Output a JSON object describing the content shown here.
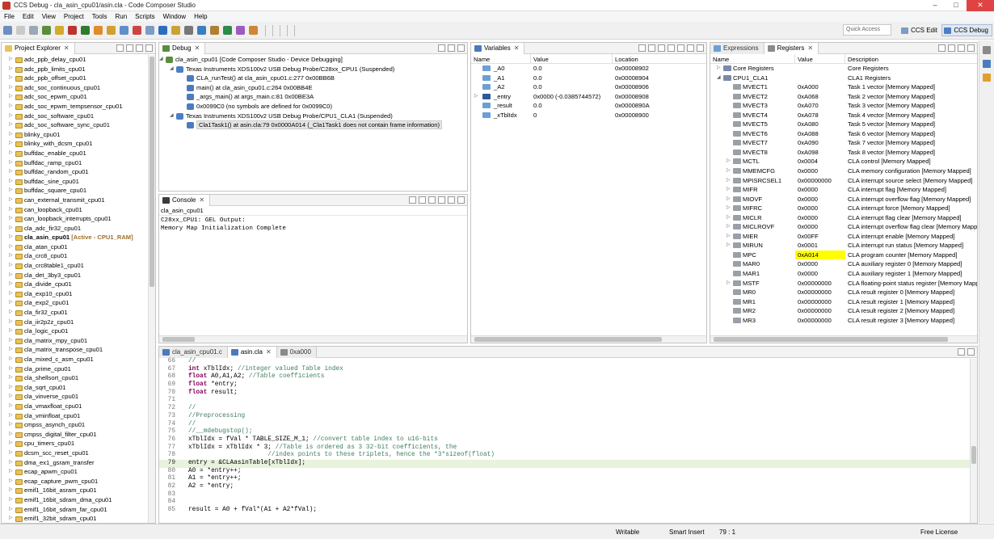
{
  "window": {
    "title": "CCS Debug - cla_asin_cpu01/asin.cla - Code Composer Studio"
  },
  "menu": [
    "File",
    "Edit",
    "View",
    "Project",
    "Tools",
    "Run",
    "Scripts",
    "Window",
    "Help"
  ],
  "toolbar": {
    "quick_access": "Quick Access",
    "persp_edit": "CCS Edit",
    "persp_debug": "CCS Debug"
  },
  "project_explorer": {
    "tab": "Project Explorer",
    "items": [
      "adc_ppb_delay_cpu01",
      "adc_ppb_limits_cpu01",
      "adc_ppb_offset_cpu01",
      "adc_soc_continuous_cpu01",
      "adc_soc_epwm_cpu01",
      "adc_soc_epwm_tempsensor_cpu01",
      "adc_soc_software_cpu01",
      "adc_soc_software_sync_cpu01",
      "blinky_cpu01",
      "blinky_with_dcsm_cpu01",
      "buffdac_enable_cpu01",
      "buffdac_ramp_cpu01",
      "buffdac_random_cpu01",
      "buffdac_sine_cpu01",
      "buffdac_square_cpu01",
      "can_external_transmit_cpu01",
      "can_loopback_cpu01",
      "can_loopback_interrupts_cpu01",
      "cla_adc_fir32_cpu01",
      "cla_asin_cpu01",
      "cla_atan_cpu01",
      "cla_crc8_cpu01",
      "cla_crc8table1_cpu01",
      "cla_det_3by3_cpu01",
      "cla_divide_cpu01",
      "cla_exp10_cpu01",
      "cla_exp2_cpu01",
      "cla_fir32_cpu01",
      "cla_iir2p2z_cpu01",
      "cla_logic_cpu01",
      "cla_matrix_mpy_cpu01",
      "cla_matrix_transpose_cpu01",
      "cla_mixed_c_asm_cpu01",
      "cla_prime_cpu01",
      "cla_shellsort_cpu01",
      "cla_sqrt_cpu01",
      "cla_vinverse_cpu01",
      "cla_vmaxfloat_cpu01",
      "cla_vminfloat_cpu01",
      "cmpss_asynch_cpu01",
      "cmpss_digital_filter_cpu01",
      "cpu_timers_cpu01",
      "dcsm_scc_reset_cpu01",
      "dma_ex1_gsram_transfer",
      "ecap_apwm_cpu01",
      "ecap_capture_pwm_cpu01",
      "emif1_16bit_asram_cpu01",
      "emif1_16bit_sdram_dma_cpu01",
      "emif1_16bit_sdram_far_cpu01",
      "emif1_32bit_sdram_cpu01"
    ],
    "active_index": 19,
    "active_suffix": "[Active - CPU1_RAM]"
  },
  "debug": {
    "tab": "Debug",
    "rows": [
      {
        "text": "cla_asin_cpu01 [Code Composer Studio - Device Debugging]",
        "indent": 0
      },
      {
        "text": "Texas Instruments XDS100v2 USB Debug Probe/C28xx_CPU1 (Suspended)",
        "indent": 1
      },
      {
        "text": "CLA_runTest() at cla_asin_cpu01.c:277 0x00BB6B",
        "indent": 2
      },
      {
        "text": "main() at cla_asin_cpu01.c:264 0x00BB4E",
        "indent": 2
      },
      {
        "text": "_args_main() at args_main.c:81 0x00BE3A",
        "indent": 2
      },
      {
        "text": "0x0099C0  (no symbols are defined for 0x0099C0)",
        "indent": 2
      },
      {
        "text": "Texas Instruments XDS100v2 USB Debug Probe/CPU1_CLA1 (Suspended)",
        "indent": 1
      },
      {
        "text": "Cla1Task1() at asin.cla:79 0x0000A014  (_Cla1Task1 does not contain frame information)",
        "indent": 2,
        "selected": true
      }
    ]
  },
  "variables": {
    "tab": "Variables",
    "headers": [
      "Name",
      "Value",
      "Location"
    ],
    "rows": [
      {
        "name": "_A0",
        "value": "0.0",
        "loc": "0x00008902"
      },
      {
        "name": "_A1",
        "value": "0.0",
        "loc": "0x00008904"
      },
      {
        "name": "_A2",
        "value": "0.0",
        "loc": "0x00008906"
      },
      {
        "name": "_entry",
        "value": "0x0000 (-0.0385744572)",
        "loc": "0x00008908"
      },
      {
        "name": "_result",
        "value": "0.0",
        "loc": "0x0000890A"
      },
      {
        "name": "_xTblIdx",
        "value": "0",
        "loc": "0x00008900"
      }
    ]
  },
  "registers": {
    "tab_expr": "Expressions",
    "tab": "Registers",
    "headers": [
      "Name",
      "Value",
      "Description"
    ],
    "rows": [
      {
        "name": "Core Registers",
        "value": "",
        "desc": "Core Registers",
        "lvl": 0,
        "exp": "▷"
      },
      {
        "name": "CPU1_CLA1",
        "value": "",
        "desc": "CLA1 Registers",
        "lvl": 0,
        "exp": "◢"
      },
      {
        "name": "MVECT1",
        "value": "0xA000",
        "desc": "Task 1 vector [Memory Mapped]",
        "lvl": 1,
        "exp": ""
      },
      {
        "name": "MVECT2",
        "value": "0xA068",
        "desc": "Task 2 vector [Memory Mapped]",
        "lvl": 1,
        "exp": ""
      },
      {
        "name": "MVECT3",
        "value": "0xA070",
        "desc": "Task 3 vector [Memory Mapped]",
        "lvl": 1,
        "exp": ""
      },
      {
        "name": "MVECT4",
        "value": "0xA078",
        "desc": "Task 4 vector [Memory Mapped]",
        "lvl": 1,
        "exp": ""
      },
      {
        "name": "MVECT5",
        "value": "0xA080",
        "desc": "Task 5 vector [Memory Mapped]",
        "lvl": 1,
        "exp": ""
      },
      {
        "name": "MVECT6",
        "value": "0xA088",
        "desc": "Task 6 vector [Memory Mapped]",
        "lvl": 1,
        "exp": ""
      },
      {
        "name": "MVECT7",
        "value": "0xA090",
        "desc": "Task 7 vector [Memory Mapped]",
        "lvl": 1,
        "exp": ""
      },
      {
        "name": "MVECT8",
        "value": "0xA098",
        "desc": "Task 8 vector [Memory Mapped]",
        "lvl": 1,
        "exp": ""
      },
      {
        "name": "MCTL",
        "value": "0x0004",
        "desc": "CLA control [Memory Mapped]",
        "lvl": 1,
        "exp": "▷"
      },
      {
        "name": "MMEMCFG",
        "value": "0x0000",
        "desc": "CLA memory configuration [Memory Mapped]",
        "lvl": 1,
        "exp": "▷"
      },
      {
        "name": "MPISRCSEL1",
        "value": "0x00000000",
        "desc": "CLA interrupt source select [Memory Mapped]",
        "lvl": 1,
        "exp": "▷"
      },
      {
        "name": "MIFR",
        "value": "0x0000",
        "desc": "CLA interrupt flag [Memory Mapped]",
        "lvl": 1,
        "exp": "▷"
      },
      {
        "name": "MIOVF",
        "value": "0x0000",
        "desc": "CLA interrupt overflow flag [Memory Mapped]",
        "lvl": 1,
        "exp": "▷"
      },
      {
        "name": "MIFRC",
        "value": "0x0000",
        "desc": "CLA interrupt force [Memory Mapped]",
        "lvl": 1,
        "exp": "▷"
      },
      {
        "name": "MICLR",
        "value": "0x0000",
        "desc": "CLA interrupt flag clear [Memory Mapped]",
        "lvl": 1,
        "exp": "▷"
      },
      {
        "name": "MICLROVF",
        "value": "0x0000",
        "desc": "CLA interrupt overflow flag clear [Memory Mapp",
        "lvl": 1,
        "exp": "▷"
      },
      {
        "name": "MIER",
        "value": "0x00FF",
        "desc": "CLA interrupt enable [Memory Mapped]",
        "lvl": 1,
        "exp": "▷"
      },
      {
        "name": "MIRUN",
        "value": "0x0001",
        "desc": "CLA interrupt run status [Memory Mapped]",
        "lvl": 1,
        "exp": "▷"
      },
      {
        "name": "MPC",
        "value": "0xA014",
        "desc": "CLA program counter [Memory Mapped]",
        "lvl": 1,
        "exp": "",
        "hl": true
      },
      {
        "name": "MAR0",
        "value": "0x0000",
        "desc": "CLA auxiliary register 0 [Memory Mapped]",
        "lvl": 1,
        "exp": ""
      },
      {
        "name": "MAR1",
        "value": "0x0000",
        "desc": "CLA auxiliary register 1 [Memory Mapped]",
        "lvl": 1,
        "exp": ""
      },
      {
        "name": "MSTF",
        "value": "0x00000000",
        "desc": "CLA floating-point status register [Memory Mapp",
        "lvl": 1,
        "exp": "▷"
      },
      {
        "name": "MR0",
        "value": "0x00000000",
        "desc": "CLA result register 0 [Memory Mapped]",
        "lvl": 1,
        "exp": ""
      },
      {
        "name": "MR1",
        "value": "0x00000000",
        "desc": "CLA result register 1 [Memory Mapped]",
        "lvl": 1,
        "exp": ""
      },
      {
        "name": "MR2",
        "value": "0x00000000",
        "desc": "CLA result register 2 [Memory Mapped]",
        "lvl": 1,
        "exp": ""
      },
      {
        "name": "MR3",
        "value": "0x00000000",
        "desc": "CLA result register 3 [Memory Mapped]",
        "lvl": 1,
        "exp": ""
      }
    ]
  },
  "console": {
    "tab": "Console",
    "subtitle": "cla_asin_cpu01",
    "lines": [
      "C28xx_CPU1: GEL Output:",
      "Memory Map Initialization Complete"
    ]
  },
  "editor": {
    "tabs": [
      "cla_asin_cpu01.c",
      "asin.cla",
      "0xa000"
    ],
    "active_tab": 1,
    "lines": [
      {
        "n": "66",
        "t": "//",
        "c": "cm"
      },
      {
        "n": "67",
        "t": "int xTblIdx; //integer valued Table index",
        "c": "mix1"
      },
      {
        "n": "68",
        "t": "float A0,A1,A2; //Table coefficients",
        "c": "mix2"
      },
      {
        "n": "69",
        "t": "float *entry;",
        "c": "kwline"
      },
      {
        "n": "70",
        "t": "float result;",
        "c": "kwline"
      },
      {
        "n": "71",
        "t": "",
        "c": ""
      },
      {
        "n": "72",
        "t": "//",
        "c": "cm"
      },
      {
        "n": "73",
        "t": "//Preprocessing",
        "c": "cm"
      },
      {
        "n": "74",
        "t": "//",
        "c": "cm"
      },
      {
        "n": "75",
        "t": "//__mdebugstop();",
        "c": "cm"
      },
      {
        "n": "76",
        "t": "xTblIdx = fVal * TABLE_SIZE_M_1; //convert table index to u16-bits",
        "c": "mix3"
      },
      {
        "n": "77",
        "t": "xTblIdx = xTblIdx * 3; //Table is ordered as 3 32-bit coefficients, the",
        "c": "mix4"
      },
      {
        "n": "78",
        "t": "                     //index points to these triplets, hence the *3*sizeof(float)",
        "c": "cm"
      },
      {
        "n": "79",
        "t": "entry = &CLAasinTable[xTblIdx];",
        "c": "",
        "cur": true
      },
      {
        "n": "80",
        "t": "A0 = *entry++;",
        "c": ""
      },
      {
        "n": "81",
        "t": "A1 = *entry++;",
        "c": ""
      },
      {
        "n": "82",
        "t": "A2 = *entry;",
        "c": ""
      },
      {
        "n": "83",
        "t": "",
        "c": ""
      },
      {
        "n": "84",
        "t": "",
        "c": ""
      },
      {
        "n": "85",
        "t": "result = A0 + fVal*(A1 + A2*fVal);",
        "c": ""
      }
    ]
  },
  "status": {
    "writable": "Writable",
    "insert": "Smart Insert",
    "pos": "79 : 1",
    "license": "Free License"
  }
}
